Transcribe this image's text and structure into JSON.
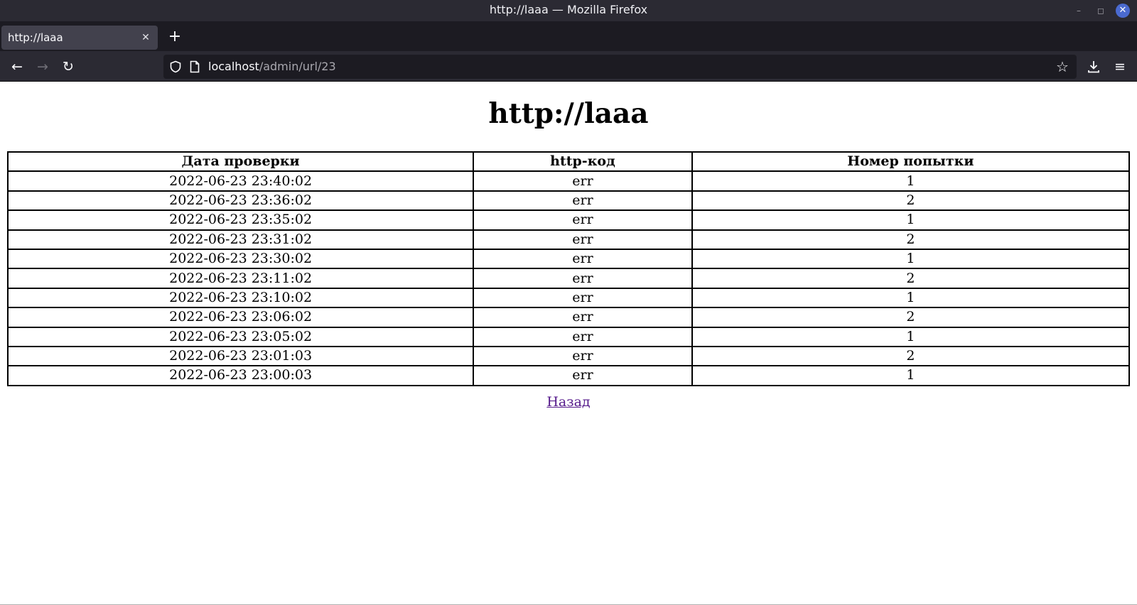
{
  "window": {
    "title": "http://laaa — Mozilla Firefox"
  },
  "tabs": [
    {
      "label": "http://laaa"
    }
  ],
  "urlbar": {
    "host": "localhost",
    "path": "/admin/url/23"
  },
  "page": {
    "heading": "http://laaa",
    "table": {
      "headers": [
        "Дата проверки",
        "http-код",
        "Номер попытки"
      ],
      "rows": [
        [
          "2022-06-23 23:40:02",
          "err",
          "1"
        ],
        [
          "2022-06-23 23:36:02",
          "err",
          "2"
        ],
        [
          "2022-06-23 23:35:02",
          "err",
          "1"
        ],
        [
          "2022-06-23 23:31:02",
          "err",
          "2"
        ],
        [
          "2022-06-23 23:30:02",
          "err",
          "1"
        ],
        [
          "2022-06-23 23:11:02",
          "err",
          "2"
        ],
        [
          "2022-06-23 23:10:02",
          "err",
          "1"
        ],
        [
          "2022-06-23 23:06:02",
          "err",
          "2"
        ],
        [
          "2022-06-23 23:05:02",
          "err",
          "1"
        ],
        [
          "2022-06-23 23:01:03",
          "err",
          "2"
        ],
        [
          "2022-06-23 23:00:03",
          "err",
          "1"
        ]
      ]
    },
    "back_link": "Назад"
  },
  "colors": {
    "chrome_dark": "#2b2a33",
    "tab_active": "#42414d",
    "link_visited": "#551a8b"
  }
}
